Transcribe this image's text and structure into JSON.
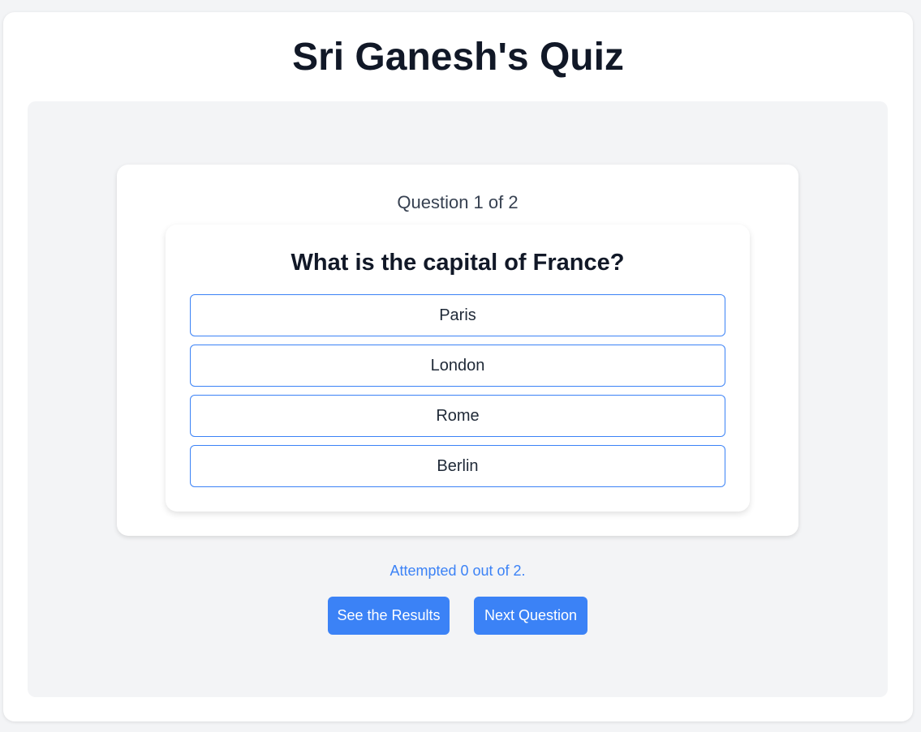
{
  "page": {
    "title": "Sri Ganesh's Quiz"
  },
  "quiz": {
    "counter": "Question 1 of 2",
    "question": "What is the capital of France?",
    "options": [
      "Paris",
      "London",
      "Rome",
      "Berlin"
    ],
    "attempted": "Attempted 0 out of 2.",
    "buttons": {
      "results": "See the Results",
      "next": "Next Question"
    }
  },
  "colors": {
    "accent": "#3b82f6",
    "background": "#f3f4f6",
    "card": "#ffffff",
    "heading": "#111827"
  }
}
